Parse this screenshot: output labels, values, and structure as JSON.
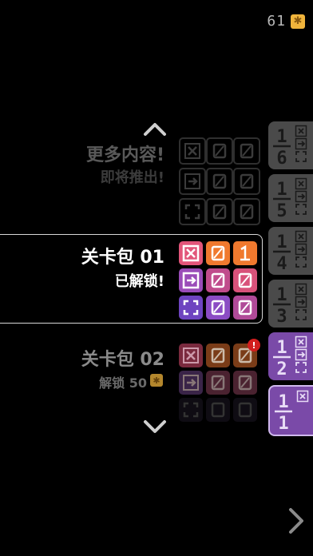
{
  "coins": {
    "count": "61",
    "icon": "coin-icon"
  },
  "packs": [
    {
      "title": "更多内容!",
      "subtitle": "即将推出!",
      "state": "coming-soon"
    },
    {
      "title": "关卡包 01",
      "subtitle": "已解锁!",
      "state": "unlocked"
    },
    {
      "title": "关卡包 02",
      "subtitle": "解锁 50",
      "state": "locked",
      "badge": "!"
    }
  ],
  "levels": [
    "1/6",
    "1/5",
    "1/4",
    "1/3",
    "1/2",
    "1/1"
  ],
  "colors": {
    "bg": "#000000",
    "pink": "#e2557a",
    "orange": "#f0792e",
    "purple": "#8b4cc4",
    "magenta": "#c04c8c",
    "gray": "#5a5a5a",
    "coin": "#f0b43c",
    "badge": "#d21e1e",
    "thumb_gray": "#4a4a4a",
    "thumb_purple": "#7a4aa8"
  }
}
